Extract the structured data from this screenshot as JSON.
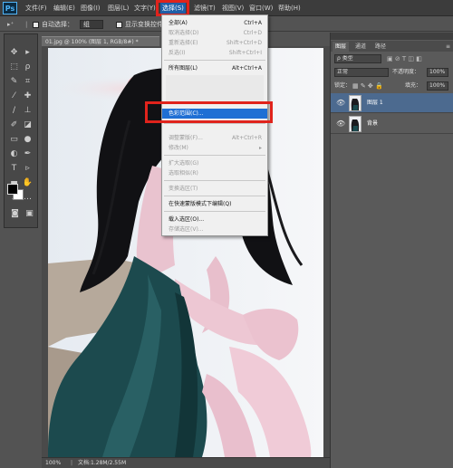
{
  "app": {
    "logo": "Ps"
  },
  "menubar": {
    "items": [
      "文件(F)",
      "编辑(E)",
      "图像(I)",
      "图层(L)",
      "文字(Y)",
      "选择(S)",
      "滤镜(T)",
      "视图(V)",
      "窗口(W)",
      "帮助(H)"
    ],
    "active": "选择(S)"
  },
  "options": {
    "auto_select_label": "自动选择：",
    "auto_select_value": "组",
    "show_transform": "显示变换控件"
  },
  "document": {
    "tab_title": "01.jpg @ 100% (图层 1, RGB/8#) *",
    "zoom": "100%",
    "doc_size": "文档:1.28M/2.55M"
  },
  "layers_panel": {
    "tabs": [
      "图层",
      "通道",
      "路径"
    ],
    "kind_filter": "ρ 类型",
    "blend_mode": "正常",
    "opacity_label": "不透明度：",
    "opacity_value": "100%",
    "lock_label": "锁定：",
    "fill_label": "填充：",
    "fill_value": "100%",
    "layers": [
      {
        "name": "图层 1",
        "selected": true
      },
      {
        "name": "背景",
        "selected": false
      }
    ]
  },
  "select_menu": {
    "items": [
      {
        "label": "全部(A)",
        "shortcut": "Ctrl+A",
        "enabled": true
      },
      {
        "label": "取消选择(D)",
        "shortcut": "Ctrl+D",
        "enabled": false
      },
      {
        "label": "重新选择(E)",
        "shortcut": "Shift+Ctrl+D",
        "enabled": false
      },
      {
        "label": "反选(I)",
        "shortcut": "Shift+Ctrl+I",
        "enabled": false
      },
      {
        "label": "所有图层(L)",
        "shortcut": "Alt+Ctrl+A",
        "enabled": true
      },
      {
        "label": "色彩范围(C)...",
        "shortcut": "",
        "enabled": true,
        "highlighted": true
      },
      {
        "label": "调整蒙版(F)...",
        "shortcut": "Alt+Ctrl+R",
        "enabled": false
      },
      {
        "label": "修改(M)",
        "shortcut": "▸",
        "enabled": false
      },
      {
        "label": "扩大选取(G)",
        "shortcut": "",
        "enabled": false
      },
      {
        "label": "选取相似(R)",
        "shortcut": "",
        "enabled": false
      },
      {
        "label": "变换选区(T)",
        "shortcut": "",
        "enabled": false
      },
      {
        "label": "在快速蒙版模式下编辑(Q)",
        "shortcut": "",
        "enabled": true
      },
      {
        "label": "载入选区(O)...",
        "shortcut": "",
        "enabled": true
      },
      {
        "label": "存储选区(V)...",
        "shortcut": "",
        "enabled": false
      }
    ]
  },
  "colors": {
    "highlight": "#1f6fd4",
    "annotation_red": "#e0231c",
    "dress_teal": "#1c4a4e"
  }
}
